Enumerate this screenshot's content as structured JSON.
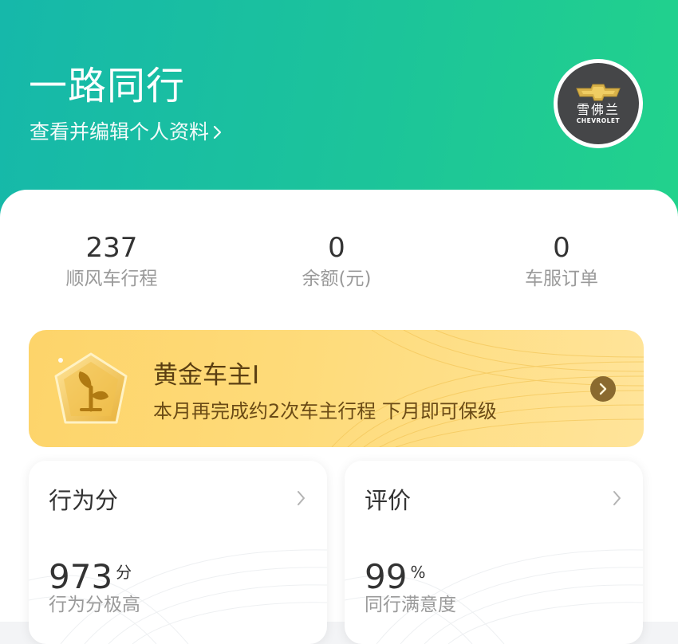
{
  "header": {
    "title": "一路同行",
    "profile_link": "查看并编辑个人资料",
    "avatar": {
      "brand_cn": "雪佛兰",
      "brand_en": "CHEVROLET"
    }
  },
  "stats": [
    {
      "value": "237",
      "label": "顺风车行程"
    },
    {
      "value": "0",
      "label": "余额(元)"
    },
    {
      "value": "0",
      "label": "车服订单"
    }
  ],
  "level": {
    "title": "黄金车主I",
    "subtitle": "本月再完成约2次车主行程 下月即可保级",
    "badge_icon": "sprout-badge-icon"
  },
  "cards": {
    "behavior": {
      "title": "行为分",
      "value": "973",
      "unit": "分",
      "desc": "行为分极高"
    },
    "rating": {
      "title": "评价",
      "value": "99",
      "unit": "%",
      "desc": "同行满意度"
    }
  },
  "colors": {
    "header_start": "#16b8aa",
    "header_end": "#22d28c",
    "gold": "#fdd46a",
    "text_primary": "#333333",
    "text_secondary": "#9a9a9a"
  }
}
